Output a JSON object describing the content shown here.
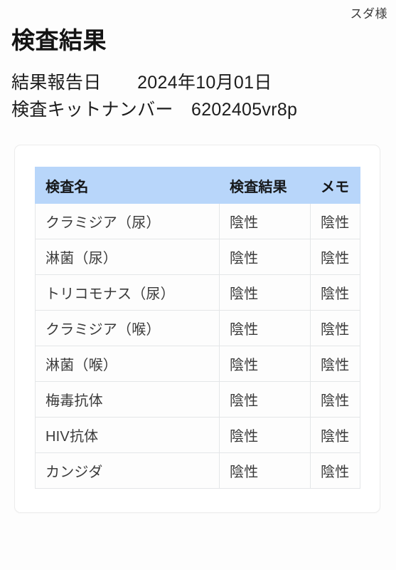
{
  "header": {
    "customer_name": "スダ様"
  },
  "page": {
    "title": "検査結果",
    "report_date_label": "結果報告日",
    "report_date_value": "2024年10月01日",
    "kit_number_label": "検査キットナンバー",
    "kit_number_value": "6202405vr8p",
    "report_date_line": "結果報告日　　2024年10月01日",
    "kit_number_line": "検査キットナンバー　6202405vr8p"
  },
  "colors": {
    "page_background": "#fdfdfd",
    "card_background": "#ffffff",
    "card_border": "#ececec",
    "table_header_background": "#b8d6fa",
    "table_border": "#e4e6e8",
    "heading_text": "#141414",
    "cell_text": "#3a3a3a"
  },
  "table": {
    "columns": [
      {
        "key": "test_name",
        "label": "検査名"
      },
      {
        "key": "test_result",
        "label": "検査結果"
      },
      {
        "key": "memo",
        "label": "メモ"
      }
    ],
    "rows": [
      {
        "test_name": "クラミジア（尿）",
        "test_result": "陰性",
        "memo": "陰性"
      },
      {
        "test_name": "淋菌（尿）",
        "test_result": "陰性",
        "memo": "陰性"
      },
      {
        "test_name": "トリコモナス（尿）",
        "test_result": "陰性",
        "memo": "陰性"
      },
      {
        "test_name": "クラミジア（喉）",
        "test_result": "陰性",
        "memo": "陰性"
      },
      {
        "test_name": "淋菌（喉）",
        "test_result": "陰性",
        "memo": "陰性"
      },
      {
        "test_name": "梅毒抗体",
        "test_result": "陰性",
        "memo": "陰性"
      },
      {
        "test_name": "HIV抗体",
        "test_result": "陰性",
        "memo": "陰性"
      },
      {
        "test_name": "カンジダ",
        "test_result": "陰性",
        "memo": "陰性"
      }
    ]
  }
}
